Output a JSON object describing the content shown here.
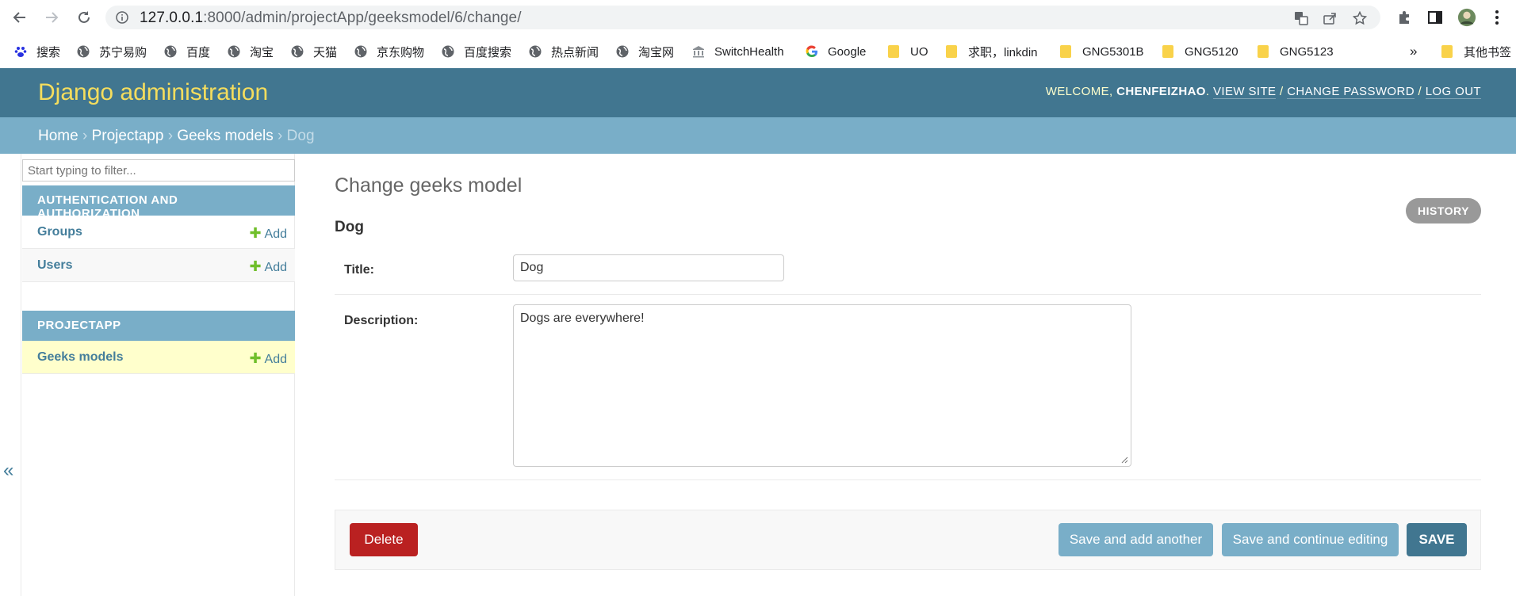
{
  "browser": {
    "url_host": "127.0.0.1",
    "url_rest": ":8000/admin/projectApp/geeksmodel/6/change/",
    "bookmarks": [
      {
        "label": "搜索",
        "icon": "baidu-paw-icon"
      },
      {
        "label": "苏宁易购",
        "icon": "globe-icon"
      },
      {
        "label": "百度",
        "icon": "globe-icon"
      },
      {
        "label": "淘宝",
        "icon": "globe-icon"
      },
      {
        "label": "天猫",
        "icon": "globe-icon"
      },
      {
        "label": "京东购物",
        "icon": "globe-icon"
      },
      {
        "label": "百度搜索",
        "icon": "globe-icon"
      },
      {
        "label": "热点新闻",
        "icon": "globe-icon"
      },
      {
        "label": "淘宝网",
        "icon": "globe-icon"
      },
      {
        "label": "SwitchHealth",
        "icon": "building-icon"
      },
      {
        "label": "Google",
        "icon": "google-icon"
      },
      {
        "label": "UO",
        "icon": "folder-icon"
      },
      {
        "label": "求职，linkdin",
        "icon": "folder-icon"
      },
      {
        "label": "GNG5301B",
        "icon": "folder-icon"
      },
      {
        "label": "GNG5120",
        "icon": "folder-icon"
      },
      {
        "label": "GNG5123",
        "icon": "folder-icon"
      }
    ],
    "overflow_label": "»",
    "other_bookmarks": "其他书签"
  },
  "header": {
    "brand": "Django administration",
    "welcome": "Welcome,",
    "username": "chenfeizhao",
    "view_site": "View site",
    "change_password": "Change password",
    "log_out": "Log out",
    "separator": "/"
  },
  "breadcrumbs": {
    "home": "Home",
    "app": "Projectapp",
    "model": "Geeks models",
    "current": "Dog",
    "sep": "›"
  },
  "sidebar": {
    "filter_placeholder": "Start typing to filter...",
    "auth_caption": "Authentication and Authorization",
    "groups": "Groups",
    "users": "Users",
    "add": "Add",
    "project_caption": "Projectapp",
    "geeks_models": "Geeks models",
    "collapse": "«"
  },
  "content": {
    "title": "Change geeks model",
    "history": "History",
    "object_name": "Dog",
    "title_label": "Title:",
    "title_value": "Dog",
    "description_label": "Description:",
    "description_value": "Dogs are everywhere!"
  },
  "submit": {
    "delete": "Delete",
    "save_add_another": "Save and add another",
    "save_continue": "Save and continue editing",
    "save": "SAVE"
  },
  "colors": {
    "header_bg": "#417690",
    "brand": "#f5dd5d",
    "breadcrumb_bg": "#79aec8",
    "delete_bg": "#ba2121",
    "selected_row_bg": "#ffffcc"
  }
}
